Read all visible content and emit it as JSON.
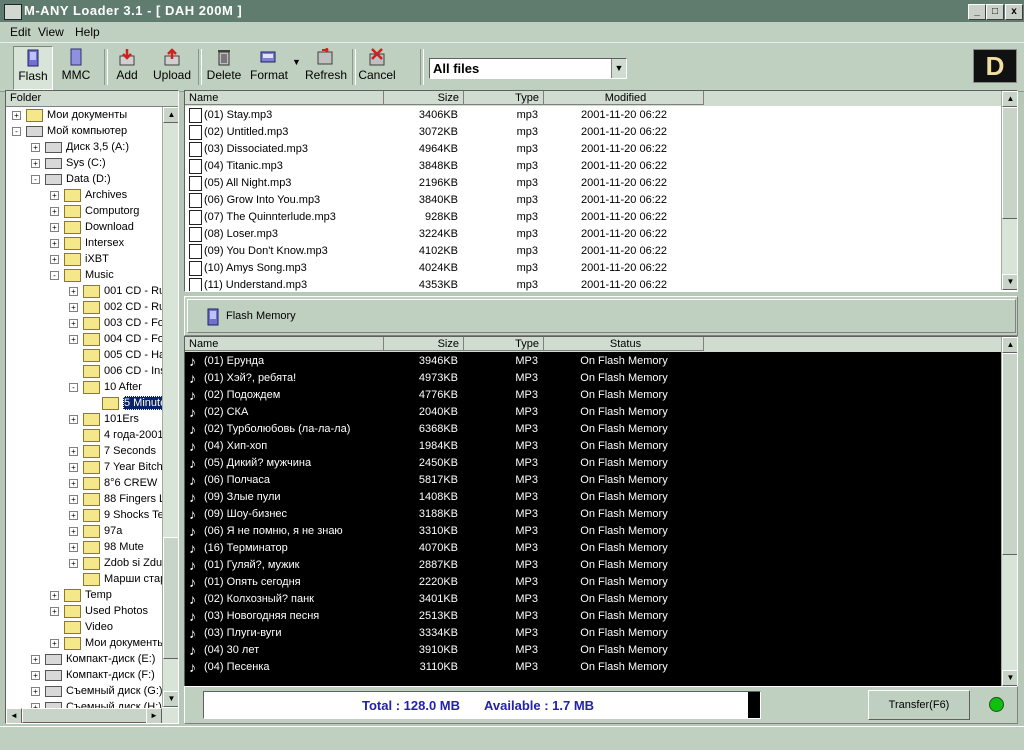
{
  "window": {
    "title": "M-ANY Loader 3.1 - [ DAH 200M ]",
    "min": "_",
    "max": "□",
    "close": "x"
  },
  "menu": [
    "Edit",
    "View",
    "Help"
  ],
  "toolbar": {
    "flash": "Flash",
    "mmc": "MMC",
    "add": "Add",
    "upload": "Upload",
    "delete": "Delete",
    "format": "Format",
    "refresh": "Refresh",
    "cancel": "Cancel"
  },
  "filter": {
    "value": "All files"
  },
  "logo": "D",
  "folder_pane": {
    "header": "Folder",
    "items": [
      {
        "label": "Мои документы",
        "type": "folder"
      },
      {
        "label": "Мой компьютер",
        "type": "drive"
      },
      {
        "label": "Диск 3,5 (A:)",
        "type": "drive"
      },
      {
        "label": "Sys (C:)",
        "type": "drive"
      },
      {
        "label": "Data (D:)",
        "type": "drive"
      },
      {
        "label": "Archives",
        "type": "folder"
      },
      {
        "label": "Computorg",
        "type": "folder"
      },
      {
        "label": "Download",
        "type": "folder"
      },
      {
        "label": "Intersex",
        "type": "folder"
      },
      {
        "label": "iXBT",
        "type": "folder"
      },
      {
        "label": "Music",
        "type": "folder"
      },
      {
        "label": "001 CD - Ru",
        "type": "folder"
      },
      {
        "label": "002 CD - Ru",
        "type": "folder"
      },
      {
        "label": "003 CD - Fo",
        "type": "folder"
      },
      {
        "label": "004 CD - Fo",
        "type": "folder"
      },
      {
        "label": "005 CD - Ha",
        "type": "folder"
      },
      {
        "label": "006 CD - Ins",
        "type": "folder"
      },
      {
        "label": "10 After",
        "type": "folder"
      },
      {
        "label": "5 Minute",
        "type": "folder"
      },
      {
        "label": "101Ers",
        "type": "folder"
      },
      {
        "label": "4 года-2001",
        "type": "folder"
      },
      {
        "label": "7 Seconds",
        "type": "folder"
      },
      {
        "label": "7 Year Bitch",
        "type": "folder"
      },
      {
        "label": "8°6 CREW",
        "type": "folder"
      },
      {
        "label": "88 Fingers L",
        "type": "folder"
      },
      {
        "label": "9 Shocks Te",
        "type": "folder"
      },
      {
        "label": "97a",
        "type": "folder"
      },
      {
        "label": "98 Mute",
        "type": "folder"
      },
      {
        "label": "Zdob si Zdu",
        "type": "folder"
      },
      {
        "label": "Марши стар",
        "type": "folder"
      },
      {
        "label": "Temp",
        "type": "folder"
      },
      {
        "label": "Used Photos",
        "type": "folder"
      },
      {
        "label": "Video",
        "type": "folder"
      },
      {
        "label": "Мои документы",
        "type": "folder"
      },
      {
        "label": "Компакт-диск (E:)",
        "type": "drive"
      },
      {
        "label": "Компакт-диск (F:)",
        "type": "drive"
      },
      {
        "label": "Съемный диск (G:)",
        "type": "drive"
      },
      {
        "label": "Съемный диск (H:)",
        "type": "drive"
      }
    ]
  },
  "files": {
    "columns": [
      "Name",
      "Size",
      "Type",
      "Modified"
    ],
    "rows": [
      [
        "(01) Stay.mp3",
        "3406KB",
        "mp3",
        "2001-11-20 06:22"
      ],
      [
        "(02) Untitled.mp3",
        "3072KB",
        "mp3",
        "2001-11-20 06:22"
      ],
      [
        "(03) Dissociated.mp3",
        "4964KB",
        "mp3",
        "2001-11-20 06:22"
      ],
      [
        "(04) Titanic.mp3",
        "3848KB",
        "mp3",
        "2001-11-20 06:22"
      ],
      [
        "(05) All Night.mp3",
        "2196KB",
        "mp3",
        "2001-11-20 06:22"
      ],
      [
        "(06) Grow Into You.mp3",
        "3840KB",
        "mp3",
        "2001-11-20 06:22"
      ],
      [
        "(07) The Quinnterlude.mp3",
        "928KB",
        "mp3",
        "2001-11-20 06:22"
      ],
      [
        "(08) Loser.mp3",
        "3224KB",
        "mp3",
        "2001-11-20 06:22"
      ],
      [
        "(09) You Don't Know.mp3",
        "4102KB",
        "mp3",
        "2001-11-20 06:22"
      ],
      [
        "(10) Amys Song.mp3",
        "4024KB",
        "mp3",
        "2001-11-20 06:22"
      ],
      [
        "(11) Understand.mp3",
        "4353KB",
        "mp3",
        "2001-11-20 06:22"
      ]
    ]
  },
  "flash_memory_label": "Flash Memory",
  "flash": {
    "columns": [
      "Name",
      "Size",
      "Type",
      "Status"
    ],
    "rows": [
      [
        "(01) Ерунда",
        "3946KB",
        "MP3",
        "On Flash Memory"
      ],
      [
        "(01) Хэй?, ребята!",
        "4973KB",
        "MP3",
        "On Flash Memory"
      ],
      [
        "(02) Подождем",
        "4776KB",
        "MP3",
        "On Flash Memory"
      ],
      [
        "(02) СКА",
        "2040KB",
        "MP3",
        "On Flash Memory"
      ],
      [
        "(02) Турболюбовь (ла-ла-ла)",
        "6368KB",
        "MP3",
        "On Flash Memory"
      ],
      [
        "(04) Хип-хоп",
        "1984KB",
        "MP3",
        "On Flash Memory"
      ],
      [
        "(05) Дикий? мужчина",
        "2450KB",
        "MP3",
        "On Flash Memory"
      ],
      [
        "(06) Полчаса",
        "5817KB",
        "MP3",
        "On Flash Memory"
      ],
      [
        "(09) Злые пули",
        "1408KB",
        "MP3",
        "On Flash Memory"
      ],
      [
        "(09) Шоу-бизнес",
        "3188KB",
        "MP3",
        "On Flash Memory"
      ],
      [
        "(06) Я не помню, я не знаю",
        "3310KB",
        "MP3",
        "On Flash Memory"
      ],
      [
        "(16) Терминатор",
        "4070KB",
        "MP3",
        "On Flash Memory"
      ],
      [
        "(01) Гуляй?, мужик",
        "2887KB",
        "MP3",
        "On Flash Memory"
      ],
      [
        "(01) Опять сегодня",
        "2220KB",
        "MP3",
        "On Flash Memory"
      ],
      [
        "(02) Колхозный? панк",
        "3401KB",
        "MP3",
        "On Flash Memory"
      ],
      [
        "(03) Новогодняя песня",
        "2513KB",
        "MP3",
        "On Flash Memory"
      ],
      [
        "(03) Плуги-вуги",
        "3334KB",
        "MP3",
        "On Flash Memory"
      ],
      [
        "(04) 30 лет",
        "3910KB",
        "MP3",
        "On Flash Memory"
      ],
      [
        "(04) Песенка",
        "3110KB",
        "MP3",
        "On Flash Memory"
      ]
    ]
  },
  "status": {
    "total": "Total : 128.0 MB",
    "available": "Available : 1.7 MB",
    "used_fraction": 0.987,
    "transfer_button": "Transfer(F6)",
    "led_color": "#10c010"
  },
  "colors": {
    "titlebar": "#5f7c6f",
    "face": "#c0d0c0",
    "status_text": "#2222aa"
  }
}
